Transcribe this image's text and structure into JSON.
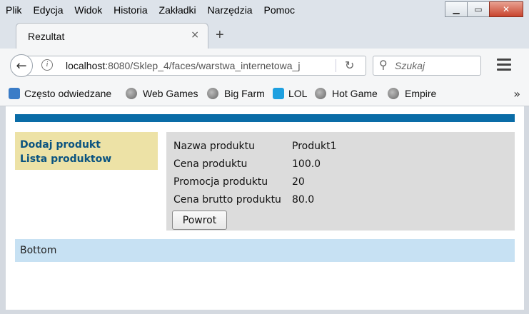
{
  "menu": [
    "Plik",
    "Edycja",
    "Widok",
    "Historia",
    "Zakładki",
    "Narzędzia",
    "Pomoc"
  ],
  "tab": {
    "title": "Rezultat",
    "close": "×",
    "new": "+"
  },
  "nav": {
    "url_host": "localhost",
    "url_path": ":8080/Sklep_4/faces/warstwa_internetowa_j",
    "search_placeholder": "Szukaj"
  },
  "bookmarks": [
    "Często odwiedzane",
    "Web Games",
    "Big Farm",
    "LOL",
    "Hot Game",
    "Empire"
  ],
  "sidebar": {
    "items": [
      {
        "label": "Dodaj produkt"
      },
      {
        "label": "Lista produktow"
      }
    ]
  },
  "product": {
    "rows": [
      {
        "label": "Nazwa produktu",
        "value": "Produkt1"
      },
      {
        "label": "Cena produktu",
        "value": "100.0"
      },
      {
        "label": "Promocja produktu",
        "value": "20"
      },
      {
        "label": "Cena brutto produktu",
        "value": "80.0"
      }
    ],
    "back_label": "Powrot"
  },
  "footer": {
    "text": "Bottom"
  },
  "colors": {
    "topbar": "#0a6ca7",
    "menu_bg": "#ede2a6",
    "panel_bg": "#dcdcdc",
    "footer_bg": "#c7e1f3",
    "link": "#0a5380"
  }
}
